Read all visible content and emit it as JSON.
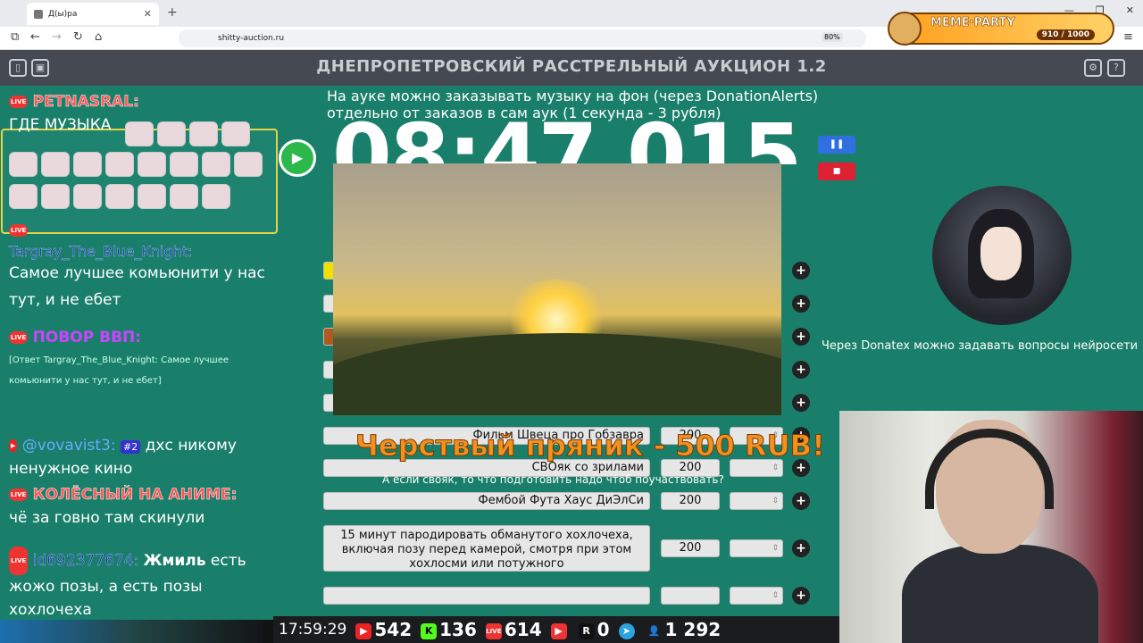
{
  "browser": {
    "tab_title": "Д(ы)ра",
    "url": "shitty-auction.ru",
    "zoom": "80%"
  },
  "meme_party": {
    "title": "MEME·PARTY",
    "count": "910 / 1000"
  },
  "app": {
    "title": "ДНЕПРОПЕТРОВСКИЙ РАССТРЕЛЬНЫЙ АУКЦИОН 1.2"
  },
  "music_note": "На ауке можно заказывать музыку на фон (через DonationAlerts) отдельно от заказов в сам аук (1 секунда - 3 рубля)",
  "timer": "08:47.015",
  "chat": [
    {
      "user": "PETNASRAL:",
      "text": "ГДЕ МУЗЫКА"
    },
    {
      "user": "Targray_The_Blue_Knight:",
      "text": "Самое лучшее комьюнити у нас тут, и не ебет"
    },
    {
      "user": "ПОВОР ВВП:",
      "reply": "[Ответ Targray_The_Blue_Knight: Самое лучшее комьюнити у нас тут, и не ебет]"
    },
    {
      "user": "@vovavist3:",
      "badge": "#2",
      "text": "дхс никому ненужное кино"
    },
    {
      "user": "КОЛЁСНЫЙ НА АНИМЕ:",
      "text": "чё за говно там скинули"
    },
    {
      "user": "id692377674:",
      "bold": "Жмиль",
      "text": " есть жожо позы, а есть позы хохлочеха"
    }
  ],
  "lots": [
    {
      "title": "Фильм Швеца про Гобзавра",
      "amount": "200"
    },
    {
      "title": "СВОяк со зрилами",
      "amount": "200"
    },
    {
      "title": "Фембой Футa Хаус ДиЭлСи",
      "amount": "200"
    },
    {
      "title": "15 минут пародировать обманутого хохлочеха, включая позу перед камерой, смотря при этом хохлосми или потужного",
      "amount": "200"
    }
  ],
  "donation": {
    "title": "Черствый пряник - 500 RUB!",
    "message": "А если свояк, то что подготовить надо чтоб поучаствовать?"
  },
  "donatex_note": "Через Donatex можно задавать вопросы нейросети",
  "stats": {
    "time": "17:59:29",
    "youtube": "542",
    "kick": "136",
    "live": "614",
    "rutube": "0",
    "telegram": "",
    "viewers": "1 292"
  }
}
